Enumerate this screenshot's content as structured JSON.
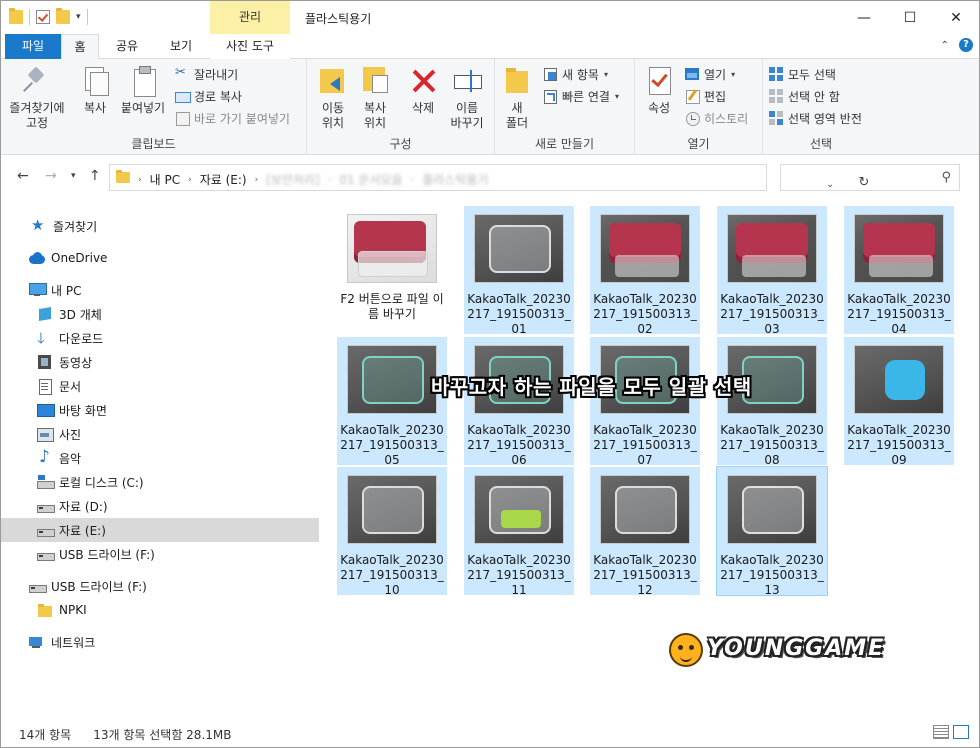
{
  "window": {
    "title": "플라스틱용기",
    "manage_tab": "관리",
    "controls": {
      "minimize": "—",
      "maximize": "☐",
      "close": "✕"
    }
  },
  "ribbon_tabs": {
    "file": "파일",
    "home": "홈",
    "share": "공유",
    "view": "보기",
    "picture_tools": "사진 도구"
  },
  "ribbon": {
    "clipboard": {
      "label": "클립보드",
      "pin": "즐겨찾기에\n고정",
      "copy": "복사",
      "paste": "붙여넣기",
      "cut": "잘라내기",
      "copy_path": "경로 복사",
      "paste_shortcut": "바로 가기 붙여넣기"
    },
    "organize": {
      "label": "구성",
      "move_to": "이동\n위치",
      "copy_to": "복사\n위치",
      "delete": "삭제",
      "rename": "이름\n바꾸기"
    },
    "new": {
      "label": "새로 만들기",
      "new_folder": "새\n폴더",
      "new_item": "새 항목",
      "easy_access": "빠른 연결"
    },
    "open": {
      "label": "열기",
      "properties": "속성",
      "open": "열기",
      "edit": "편집",
      "history": "히스토리"
    },
    "select": {
      "label": "선택",
      "select_all": "모두 선택",
      "select_none": "선택 안 함",
      "invert": "선택 영역 반전"
    }
  },
  "address": {
    "crumbs": [
      "내 PC",
      "자료 (E:)",
      "[보안처리]",
      "01 문서모음",
      "플라스틱용기"
    ],
    "search_placeholder": ""
  },
  "nav": {
    "items": [
      {
        "label": "즐겨찾기",
        "icon": "star-icon"
      },
      {
        "label": "OneDrive",
        "icon": "cloud-icon"
      },
      {
        "label": "내 PC",
        "icon": "computer-icon"
      },
      {
        "label": "3D 개체",
        "icon": "cube-icon"
      },
      {
        "label": "다운로드",
        "icon": "download-icon"
      },
      {
        "label": "동영상",
        "icon": "video-icon"
      },
      {
        "label": "문서",
        "icon": "document-icon"
      },
      {
        "label": "바탕 화면",
        "icon": "desktop-icon"
      },
      {
        "label": "사진",
        "icon": "picture-icon"
      },
      {
        "label": "음악",
        "icon": "music-icon"
      },
      {
        "label": "로컬 디스크 (C:)",
        "icon": "windows-drive-icon"
      },
      {
        "label": "자료 (D:)",
        "icon": "drive-icon"
      },
      {
        "label": "자료 (E:)",
        "icon": "drive-icon"
      },
      {
        "label": "USB 드라이브 (F:)",
        "icon": "usb-drive-icon"
      },
      {
        "label": "USB 드라이브 (F:)",
        "icon": "usb-drive-icon"
      },
      {
        "label": "NPKI",
        "icon": "folder-icon"
      },
      {
        "label": "네트워크",
        "icon": "network-icon"
      }
    ]
  },
  "files": [
    {
      "name": "F2 버튼으로 파일 이름 바꾸기",
      "selected": false,
      "thumb": "white-red"
    },
    {
      "name": "KakaoTalk_20230217_191500313_01",
      "selected": true,
      "thumb": "clear"
    },
    {
      "name": "KakaoTalk_20230217_191500313_02",
      "selected": true,
      "thumb": "red"
    },
    {
      "name": "KakaoTalk_20230217_191500313_03",
      "selected": true,
      "thumb": "red"
    },
    {
      "name": "KakaoTalk_20230217_191500313_04",
      "selected": true,
      "thumb": "red"
    },
    {
      "name": "KakaoTalk_20230217_191500313_05",
      "selected": true,
      "thumb": "green"
    },
    {
      "name": "KakaoTalk_20230217_191500313_06",
      "selected": true,
      "thumb": "green"
    },
    {
      "name": "KakaoTalk_20230217_191500313_07",
      "selected": true,
      "thumb": "green"
    },
    {
      "name": "KakaoTalk_20230217_191500313_08",
      "selected": true,
      "thumb": "green"
    },
    {
      "name": "KakaoTalk_20230217_191500313_09",
      "selected": true,
      "thumb": "blue"
    },
    {
      "name": "KakaoTalk_20230217_191500313_10",
      "selected": true,
      "thumb": "clear"
    },
    {
      "name": "KakaoTalk_20230217_191500313_11",
      "selected": true,
      "thumb": "lime"
    },
    {
      "name": "KakaoTalk_20230217_191500313_12",
      "selected": true,
      "thumb": "clear"
    },
    {
      "name": "KakaoTalk_20230217_191500313_13",
      "selected": true,
      "thumb": "clear"
    }
  ],
  "overlay": {
    "caption": "바꾸고자 하는 파일을 모두 일괄 선택",
    "logo": "YOUNGGAME"
  },
  "status": {
    "count": "14개 항목",
    "selection": "13개 항목 선택함 28.1MB"
  }
}
